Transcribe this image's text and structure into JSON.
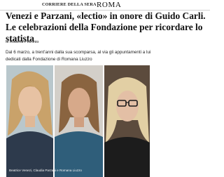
{
  "header": {
    "logo_text": "CORRIERE DELLA SERA",
    "section": "ROMA"
  },
  "article": {
    "headline": "Venezi e Parzani, «lectio» in onore di Guido Carli. Le celebrazioni della Fondazione per ricordare lo statista",
    "byline_prefix": "di",
    "author": "Roberta Petronio",
    "summary": "Dal 6 marzo, a trent'anni dalla sua scomparsa, al via gli appuntamenti a lui dedicati dalla Fondazione di Romana Liuzzo",
    "photo_caption": "Beatrice Venezi, Claudia Parzani e Romana Liuzzo"
  }
}
